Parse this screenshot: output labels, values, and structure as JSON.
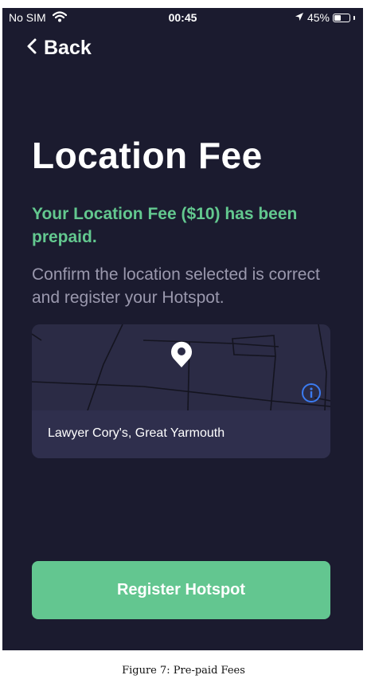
{
  "status_bar": {
    "carrier": "No SIM",
    "time": "00:45",
    "battery": "45%",
    "battery_level": 0.45
  },
  "nav": {
    "back_label": "Back"
  },
  "page": {
    "title": "Location Fee",
    "prepaid_message": "Your Location Fee ($10) has been prepaid.",
    "instruction": "Confirm the location selected is correct and register your Hotspot."
  },
  "map": {
    "location_label": "Lawyer Cory's, Great Yarmouth"
  },
  "actions": {
    "register_label": "Register Hotspot"
  },
  "caption": "Figure 7: Pre-paid Fees",
  "colors": {
    "background": "#1b1b2f",
    "accent_green": "#63c88f",
    "muted_text": "#9a98ad",
    "info_blue": "#3b7bf0"
  },
  "icons": [
    "wifi-icon",
    "location-arrow-icon",
    "battery-icon",
    "chevron-left-icon",
    "map-pin-icon",
    "info-icon"
  ]
}
